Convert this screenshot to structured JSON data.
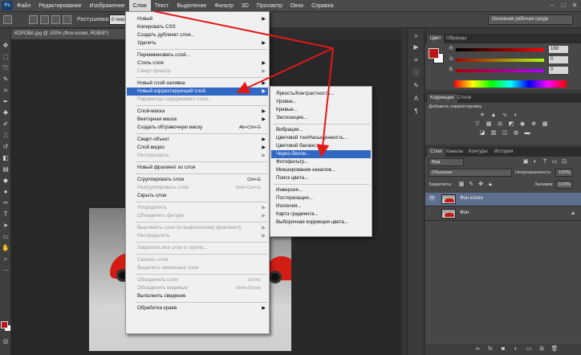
{
  "menubar": {
    "logo": "Ps",
    "items": [
      "Файл",
      "Редактирование",
      "Изображение",
      "Слои",
      "Текст",
      "Выделение",
      "Фильтр",
      "3D",
      "Просмотр",
      "Окно",
      "Справка"
    ]
  },
  "options": {
    "feather_label": "Растушевка:",
    "feather_value": "0 пикс",
    "workspace": "Основная рабочая среда"
  },
  "document": {
    "tab_title": "КОРОВА.jpg @ 100% (Фон копия, RGB/8*)"
  },
  "layers_menu": {
    "items": [
      {
        "label": "Новый",
        "arrow": true
      },
      {
        "label": "Копировать CSS"
      },
      {
        "label": "Создать дубликат слоя..."
      },
      {
        "label": "Удалить",
        "arrow": true
      },
      {
        "label": "Переименовать слой..."
      },
      {
        "label": "Стиль слоя",
        "arrow": true
      },
      {
        "label": "Смарт-фильтр",
        "disabled": true,
        "arrow": true
      },
      {
        "label": "Новый слой-заливка",
        "arrow": true
      },
      {
        "label": "Новый корректирующий слой",
        "arrow": true,
        "highlighted": true
      },
      {
        "label": "Параметры содержимого слоя...",
        "disabled": true
      },
      {
        "label": "Слой-маска",
        "arrow": true
      },
      {
        "label": "Векторная маска",
        "arrow": true
      },
      {
        "label": "Создать обтравочную маску",
        "shortcut": "Alt+Ctrl+G"
      },
      {
        "label": "Смарт-объект",
        "arrow": true
      },
      {
        "label": "Слой видео",
        "arrow": true
      },
      {
        "label": "Растрировать",
        "disabled": true,
        "arrow": true
      },
      {
        "label": "Новый фрагмент из слоя"
      },
      {
        "label": "Сгруппировать слои",
        "shortcut": "Ctrl+G"
      },
      {
        "label": "Разгруппировать слои",
        "shortcut": "Shift+Ctrl+G",
        "disabled": true
      },
      {
        "label": "Скрыть слои"
      },
      {
        "label": "Упорядочить",
        "disabled": true,
        "arrow": true
      },
      {
        "label": "Объединить фигуры",
        "disabled": true,
        "arrow": true
      },
      {
        "label": "Выровнять слои по выделенному фрагменту",
        "disabled": true,
        "arrow": true
      },
      {
        "label": "Распределить",
        "disabled": true,
        "arrow": true
      },
      {
        "label": "Закрепить все слои в группе...",
        "disabled": true
      },
      {
        "label": "Связать слои",
        "disabled": true
      },
      {
        "label": "Выделить связанные слои",
        "disabled": true
      },
      {
        "label": "Объединить слои",
        "shortcut": "Ctrl+E",
        "disabled": true
      },
      {
        "label": "Объединить видимые",
        "shortcut": "Shift+Ctrl+E",
        "disabled": true
      },
      {
        "label": "Выполнить сведение"
      },
      {
        "label": "Обработка краев",
        "arrow": true
      }
    ]
  },
  "adjustment_submenu": {
    "items": [
      {
        "label": "Яркость/Контрастность..."
      },
      {
        "label": "Уровни..."
      },
      {
        "label": "Кривые..."
      },
      {
        "label": "Экспозиция..."
      },
      {
        "label": "Вибрация..."
      },
      {
        "label": "Цветовой тон/Насыщенность..."
      },
      {
        "label": "Цветовой баланс..."
      },
      {
        "label": "Черно-белое...",
        "highlighted": true
      },
      {
        "label": "Фотофильтр..."
      },
      {
        "label": "Микширование каналов..."
      },
      {
        "label": "Поиск цвета..."
      },
      {
        "label": "Инверсия..."
      },
      {
        "label": "Постеризация..."
      },
      {
        "label": "Изогелия..."
      },
      {
        "label": "Карта градиента..."
      },
      {
        "label": "Выборочная коррекция цвета..."
      }
    ]
  },
  "color_panel": {
    "tabs": [
      "Цвет",
      "Образцы"
    ],
    "r_label": "R",
    "g_label": "G",
    "b_label": "B",
    "r": "169",
    "g": "0",
    "b": "0",
    "fg_color": "#a90000"
  },
  "adjustments_panel": {
    "tabs": [
      "Коррекция",
      "Стили"
    ],
    "title": "Добавить корректировку"
  },
  "layers_panel": {
    "tabs": [
      "Слои",
      "Каналы",
      "Контуры",
      "История"
    ],
    "filter": "Вид",
    "blend_mode": "Обычные",
    "opacity_label": "Непрозрачность:",
    "opacity": "100%",
    "lock_label": "Закрепить:",
    "fill_label": "Заливка:",
    "fill": "100%",
    "layers": [
      {
        "name": "Фон копия",
        "selected": true,
        "visible": true
      },
      {
        "name": "Фон",
        "selected": false,
        "visible": false
      }
    ]
  },
  "colors": {
    "menu_highlight": "#3168c4",
    "arrow_red": "#e01818",
    "accent_red": "#c01414"
  }
}
